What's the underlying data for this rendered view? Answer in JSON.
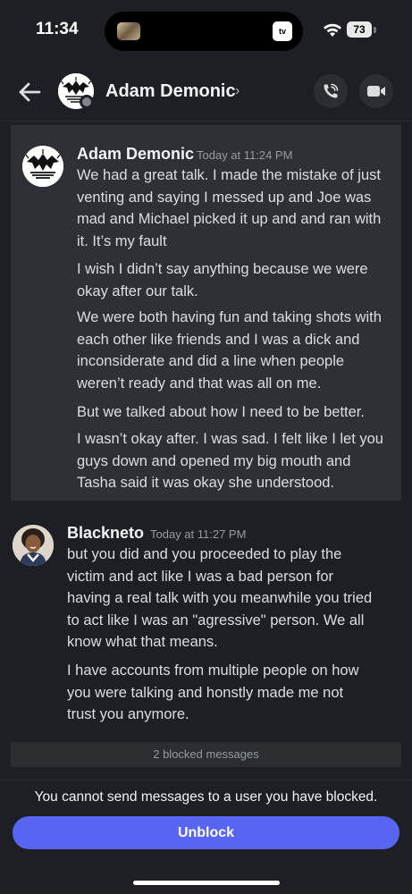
{
  "status_bar": {
    "time": "11:34",
    "battery": "73",
    "island_app": "tv"
  },
  "header": {
    "contact_name": "Adam Demonic",
    "chevron": "›",
    "status": "offline",
    "icons": [
      "back-arrow-icon",
      "phone-call-icon",
      "video-camera-icon"
    ]
  },
  "messages": [
    {
      "author": "Adam Demonic",
      "timestamp": "Today at 11:24 PM",
      "highlighted": true,
      "paragraphs": [
        [
          "We had a great talk. I made the mistake of just",
          "venting and saying I messed up and Joe was",
          "mad and Michael picked it up and and ran with",
          "it. It’s my fault"
        ],
        [
          "I wish I didn’t say anything because we were",
          "okay after our talk."
        ],
        [
          "We were both having fun and taking shots with",
          "each other like friends and I was a dick and",
          "inconsiderate and did a line when people",
          "weren’t ready and that was all on me."
        ],
        [
          "But we talked about how I need to be better."
        ],
        [
          "I wasn’t okay after. I was sad. I felt like I let you",
          "guys down and opened my big mouth and",
          "Tasha said it was okay she understood."
        ]
      ]
    },
    {
      "author": "Blackneto",
      "timestamp": "Today at 11:27 PM",
      "highlighted": false,
      "paragraphs": [
        [
          "but you did and you proceeded to play the",
          "victim and act like I was a bad person for",
          "having a real talk with you meanwhile you tried",
          "to act like I was an \"agressive\" person. We all",
          "know what that means."
        ],
        [
          "I have accounts from multiple people on how",
          "you were talking and honstly made me not",
          "trust you anymore."
        ]
      ]
    }
  ],
  "blocked_messages": "2 blocked messages",
  "footer": {
    "notice": "You cannot send messages to a user you have blocked.",
    "unblock_label": "Unblock"
  },
  "colors": {
    "background": "#1e1f24",
    "highlight": "#2e3035",
    "accent": "#5865f2",
    "muted": "#949ba4"
  }
}
